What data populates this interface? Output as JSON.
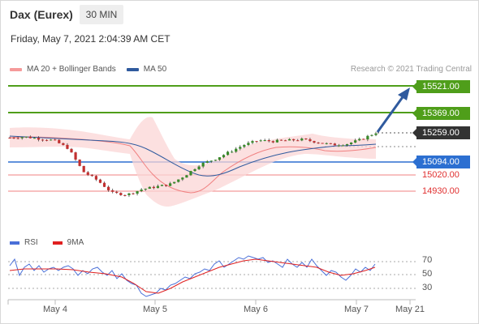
{
  "header": {
    "instrument": "Dax (Eurex)",
    "timeframe": "30 MIN",
    "datetime": "Friday, May 7, 2021 2:04:39 AM CET"
  },
  "legend": {
    "ma20_label": "MA 20 + Bollinger Bands",
    "ma20_color": "#f08080",
    "ma50_label": "MA 50",
    "ma50_color": "#2f5a9e"
  },
  "credit": "Research © 2021 Trading Central",
  "levels": {
    "r2": {
      "label": "15521.00",
      "value": 15521,
      "color": "#4f9e1a"
    },
    "r1": {
      "label": "15369.00",
      "value": 15369,
      "color": "#4f9e1a"
    },
    "last": {
      "label": "15259.00",
      "value": 15259,
      "color": "#333333"
    },
    "pivot": {
      "label": "15094.00",
      "value": 15094,
      "color": "#2c6fd1"
    },
    "s1": {
      "label": "15020.00",
      "value": 15020,
      "color": "#e03030"
    },
    "s2": {
      "label": "14930.00",
      "value": 14930,
      "color": "#e03030"
    }
  },
  "rsi": {
    "rsi_label": "RSI",
    "rsi_color": "#4a6fd8",
    "ma_label": "9MA",
    "ma_color": "#e02020",
    "ticks": [
      "70",
      "50",
      "30"
    ]
  },
  "x_axis": [
    "May 4",
    "May 5",
    "May 6",
    "May 7",
    "May 21"
  ],
  "chart_data": {
    "type": "candlestick",
    "x": [
      "May 4",
      "May 5",
      "May 6",
      "May 7",
      "May 21"
    ],
    "close_path": [
      15230,
      15235,
      15225,
      15215,
      15170,
      15040,
      14990,
      14920,
      14910,
      14940,
      14955,
      14970,
      15020,
      15080,
      15110,
      15150,
      15190,
      15215,
      15210,
      15215,
      15220,
      15205,
      15190,
      15195,
      15220,
      15259
    ],
    "support_resistance": [
      15521,
      15369,
      15259,
      15094,
      15020,
      14930
    ]
  }
}
